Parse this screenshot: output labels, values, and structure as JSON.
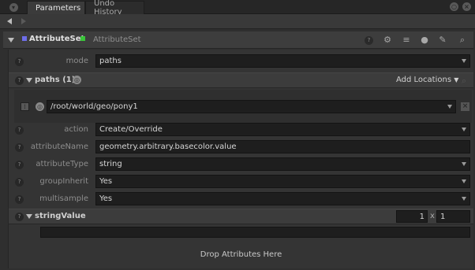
{
  "tabs": {
    "parameters": "Parameters",
    "undo_history": "Undo History"
  },
  "node": {
    "name": "AttributeSet",
    "type": "AttributeSet",
    "name_color": "#6e6ee8",
    "type_color": "#3ac53a"
  },
  "params": {
    "mode": {
      "label": "mode",
      "value": "paths"
    },
    "paths": {
      "label": "paths (1)",
      "add_locations": "Add Locations",
      "items": [
        "/root/world/geo/pony1"
      ]
    },
    "action": {
      "label": "action",
      "value": "Create/Override"
    },
    "attributeName": {
      "label": "attributeName",
      "value": "geometry.arbitrary.basecolor.value"
    },
    "attributeType": {
      "label": "attributeType",
      "value": "string"
    },
    "groupInherit": {
      "label": "groupInherit",
      "value": "Yes"
    },
    "multisample": {
      "label": "multisample",
      "value": "Yes"
    },
    "stringValue": {
      "label": "stringValue",
      "dim1": "1",
      "times": "x",
      "dim2": "1",
      "value": ""
    }
  },
  "drop_hint": "Drop Attributes Here",
  "icons": [
    "tab-menu-icon",
    "settings-icon",
    "close-icon",
    "nav-back-icon",
    "nav-forward-icon",
    "collapse-arrow-icon",
    "help-icon",
    "gear-icon",
    "filter-icon",
    "chat-icon",
    "wrench-icon",
    "search-icon"
  ]
}
